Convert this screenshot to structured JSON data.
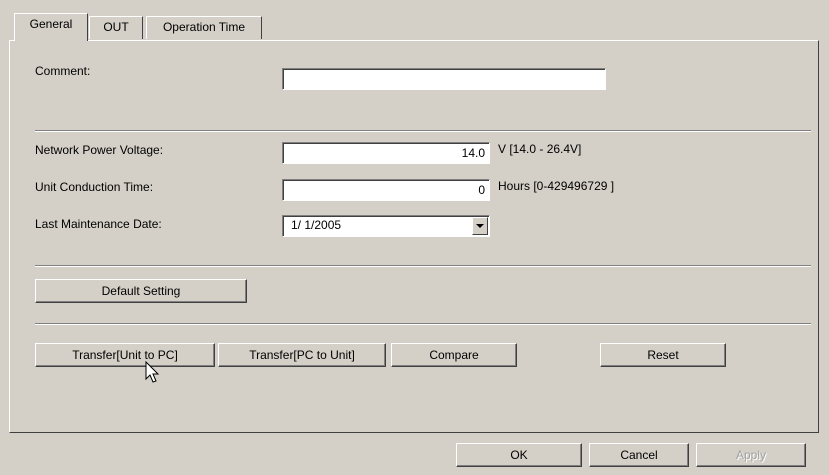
{
  "tabs": [
    {
      "label": "General",
      "active": true
    },
    {
      "label": "OUT",
      "active": false
    },
    {
      "label": "Operation Time",
      "active": false
    }
  ],
  "general": {
    "comment_label": "Comment:",
    "comment_value": "",
    "voltage_label": "Network Power Voltage:",
    "voltage_value": "14.0",
    "voltage_range": "V [14.0 - 26.4V]",
    "conduction_label": "Unit Conduction Time:",
    "conduction_value": "0",
    "conduction_range": "Hours [0-429496729 ]",
    "maintenance_label": "Last Maintenance Date:",
    "maintenance_value": "1/ 1/2005"
  },
  "buttons": {
    "default_setting": "Default Setting",
    "transfer_unit_to_pc": "Transfer[Unit to PC]",
    "transfer_pc_to_unit": "Transfer[PC to Unit]",
    "compare": "Compare",
    "reset": "Reset"
  },
  "footer": {
    "ok": "OK",
    "cancel": "Cancel",
    "apply": "Apply"
  }
}
